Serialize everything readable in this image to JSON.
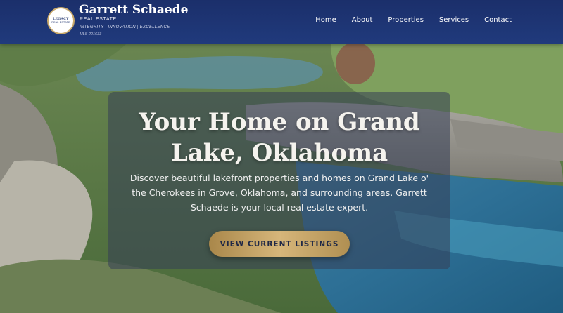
{
  "header": {
    "logo": {
      "top_text": "LEGACY",
      "bottom_text": "REAL ESTATE"
    },
    "brand_name": "Garrett Schaede",
    "brand_sub": "REAL ESTATE",
    "tagline": "INTEGRITY | INNOVATION | EXCELLENCE",
    "mls": "MLS 201633"
  },
  "nav": {
    "items": [
      {
        "label": "Home"
      },
      {
        "label": "About"
      },
      {
        "label": "Properties"
      },
      {
        "label": "Services"
      },
      {
        "label": "Contact"
      }
    ]
  },
  "hero": {
    "title": "Your Home on Grand Lake, Oklahoma",
    "description": "Discover beautiful lakefront properties and homes on Grand Lake o' the Cherokees in Grove, Oklahoma, and surrounding areas. Garrett Schaede is your local real estate expert.",
    "cta_label": "VIEW CURRENT LISTINGS"
  },
  "colors": {
    "header_bg": "#1b2f6b",
    "accent_gold": "#c9a96a",
    "card_overlay": "#343e56"
  }
}
